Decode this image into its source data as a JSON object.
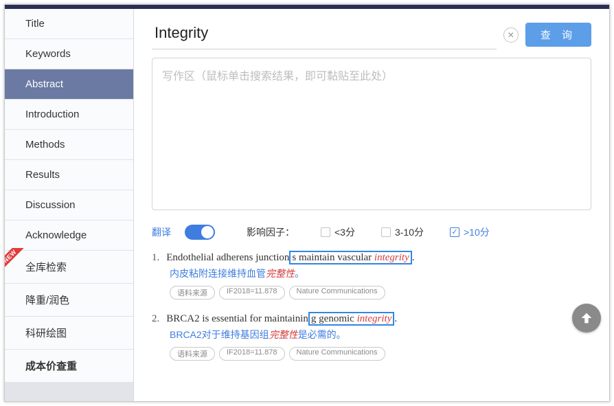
{
  "sidebar": {
    "items": [
      {
        "label": "Title"
      },
      {
        "label": "Keywords"
      },
      {
        "label": "Abstract"
      },
      {
        "label": "Introduction"
      },
      {
        "label": "Methods"
      },
      {
        "label": "Results"
      },
      {
        "label": "Discussion"
      },
      {
        "label": "Acknowledge"
      },
      {
        "label": "全库检索"
      },
      {
        "label": "降重/润色"
      },
      {
        "label": "科研绘图"
      },
      {
        "label": "成本价查重"
      }
    ],
    "new_badge": "NEW"
  },
  "search": {
    "value": "Integrity",
    "query_button": "查 询"
  },
  "writing_placeholder": "写作区（鼠标单击搜索结果，即可黏贴至此处）",
  "filters": {
    "translate_label": "翻译",
    "impact_label": "影响因子：",
    "opts": [
      {
        "label": "<3分",
        "checked": false
      },
      {
        "label": "3-10分",
        "checked": false
      },
      {
        "label": ">10分",
        "checked": true
      }
    ]
  },
  "results": [
    {
      "num": "1.",
      "en_pre": "Endothelial adherens junction",
      "en_box": "s maintain vascular ",
      "en_term": "integrity",
      "en_post": ".",
      "zh_pre": "内皮粘附连接维持血管",
      "zh_term": "完整性",
      "zh_post": "。",
      "tags": {
        "src": "语料来源",
        "if": "IF2018=11.878",
        "journal": "Nature Communications"
      }
    },
    {
      "num": "2.",
      "en_pre": "BRCA2 is essential for maintainin",
      "en_box": "g genomic ",
      "en_term": "integrity",
      "en_post": ".",
      "zh_pre": "BRCA2对于维持基因组",
      "zh_term": "完整性",
      "zh_post": "是必需的。",
      "tags": {
        "src": "语料来源",
        "if": "IF2018=11.878",
        "journal": "Nature Communications"
      }
    }
  ]
}
